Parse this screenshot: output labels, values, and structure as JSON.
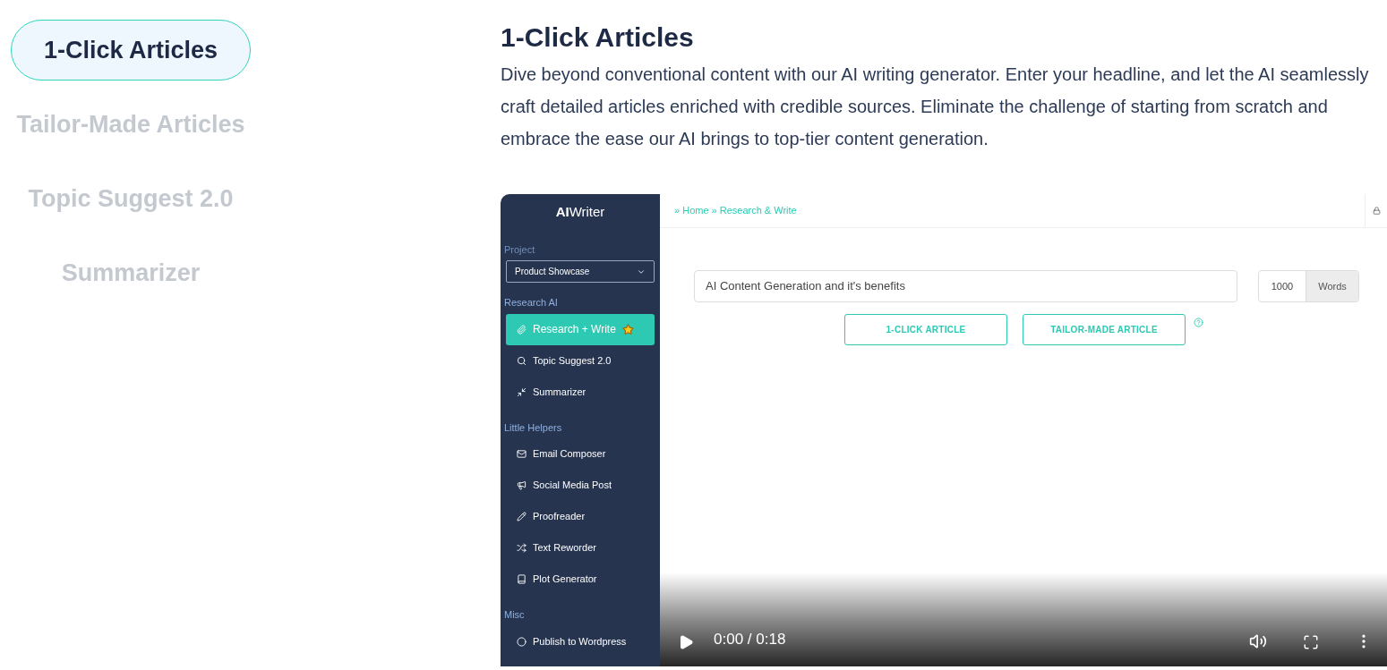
{
  "tabs": [
    {
      "label": "1-Click Articles",
      "selected": true
    },
    {
      "label": "Tailor-Made Articles",
      "selected": false
    },
    {
      "label": "Topic Suggest 2.0",
      "selected": false
    },
    {
      "label": "Summarizer",
      "selected": false
    }
  ],
  "section": {
    "title": "1-Click Articles",
    "description": "Dive beyond conventional content with our AI writing generator. Enter your headline, and let the AI seamlessly craft detailed articles enriched with credible sources. Eliminate the challenge of starting from scratch and embrace the ease our AI brings to top-tier content generation."
  },
  "video": {
    "app": {
      "logo": "**AI**Writer",
      "project": {
        "label": "Project",
        "value": "Product Showcase"
      },
      "groups": [
        {
          "heading": "Research AI",
          "items": [
            {
              "label": "Research + Write",
              "selected": true,
              "starred": true
            },
            {
              "label": "Topic Suggest 2.0",
              "selected": false,
              "starred": false
            },
            {
              "label": "Summarizer",
              "selected": false,
              "starred": false
            }
          ]
        },
        {
          "heading": "Little Helpers",
          "items": [
            {
              "label": "Email Composer",
              "selected": false,
              "starred": false
            },
            {
              "label": "Social Media Post",
              "selected": false,
              "starred": false
            },
            {
              "label": "Proofreader",
              "selected": false,
              "starred": false
            },
            {
              "label": "Text Reworder",
              "selected": false,
              "starred": false
            },
            {
              "label": "Plot Generator",
              "selected": false,
              "starred": false
            }
          ]
        },
        {
          "heading": "Misc",
          "items": [
            {
              "label": "Publish to Wordpress",
              "selected": false,
              "starred": false
            }
          ]
        }
      ],
      "breadcrumb": [
        "Home",
        "Research & Write"
      ],
      "breadcrumb_separator": "»",
      "headline": "AI Content Generation and it's benefits",
      "word_count": "1000",
      "word_unit": "Words",
      "buttons": [
        "1-CLICK ARTICLE",
        "TAILOR-MADE ARTICLE"
      ]
    },
    "controls": {
      "time": "0:00 / 0:18"
    }
  }
}
